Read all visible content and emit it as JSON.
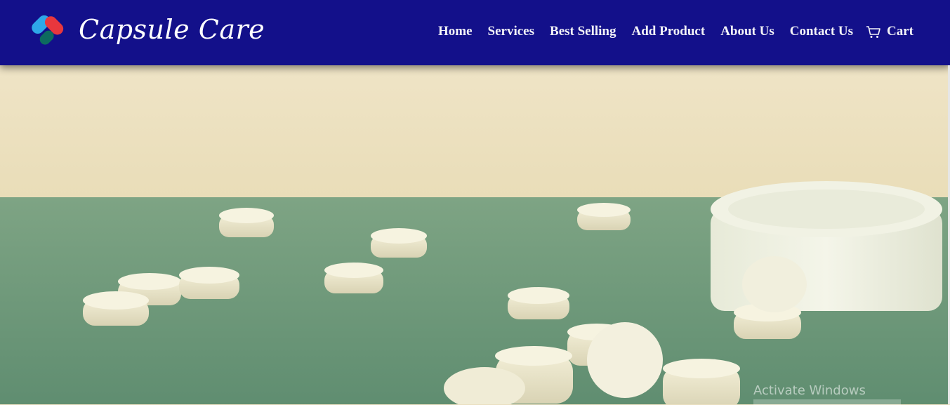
{
  "brand": {
    "name": "Capsule Care",
    "logo_icon": "capsule-heart-icon"
  },
  "nav": {
    "items": [
      "Home",
      "Services",
      "Best Selling",
      "Add Product",
      "About Us",
      "Contact Us"
    ],
    "cart_label": "Cart",
    "cart_icon": "cart-icon"
  },
  "colors": {
    "navbar_bg": "#13108a",
    "nav_text": "#f3f3f7",
    "hero_wall": "#eadfc0",
    "hero_table": "#6f9b7b"
  },
  "hero": {
    "image": "white pills on a green cloth surface beside a white bottle cap"
  },
  "watermark": {
    "text": "Activate Windows"
  }
}
